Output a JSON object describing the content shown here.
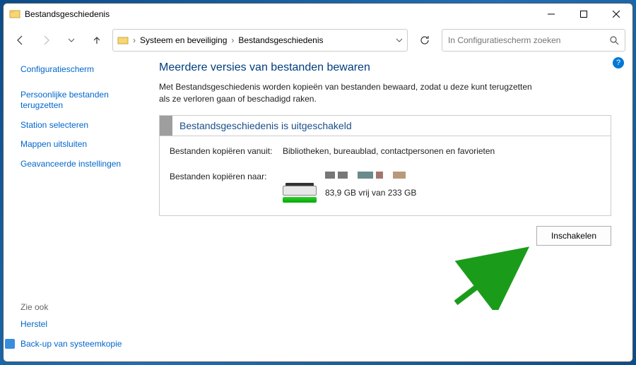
{
  "titlebar": {
    "text": "Bestandsgeschiedenis"
  },
  "breadcrumb": {
    "item1": "Systeem en beveiliging",
    "item2": "Bestandsgeschiedenis"
  },
  "search": {
    "placeholder": "In Configuratiescherm zoeken"
  },
  "sidebar": {
    "home": "Configuratiescherm",
    "links": {
      "restore": "Persoonlijke bestanden terugzetten",
      "select_drive": "Station selecteren",
      "exclude": "Mappen uitsluiten",
      "advanced": "Geavanceerde instellingen"
    },
    "see_also": "Zie ook",
    "footer": {
      "recovery": "Herstel",
      "backup": "Back-up van systeemkopie"
    }
  },
  "main": {
    "title": "Meerdere versies van bestanden bewaren",
    "description": "Met Bestandsgeschiedenis worden kopieën van bestanden bewaard, zodat u deze kunt terugzetten als ze verloren gaan of beschadigd raken.",
    "status_title": "Bestandsgeschiedenis is uitgeschakeld",
    "copy_from_label": "Bestanden kopiëren vanuit:",
    "copy_from_value": "Bibliotheken, bureaublad, contactpersonen en favorieten",
    "copy_to_label": "Bestanden kopiëren naar:",
    "drive_free": "83,9 GB vrij van 233 GB",
    "enable_button": "Inschakelen"
  },
  "help": "?"
}
